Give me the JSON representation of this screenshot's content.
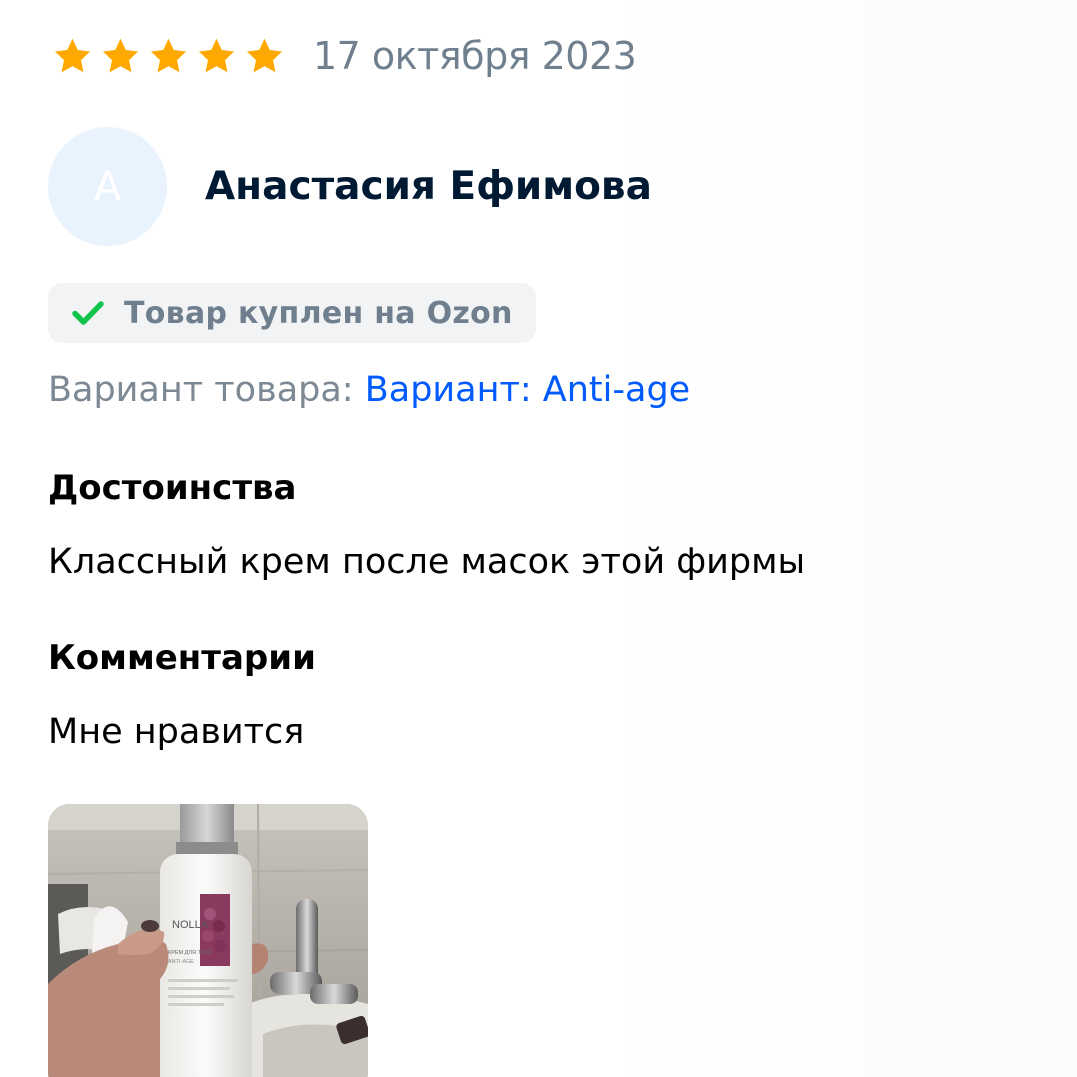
{
  "review": {
    "rating": 5,
    "rating_max": 5,
    "star_color": "#ffa800",
    "date": "17 октября 2023",
    "author": {
      "initial": "А",
      "name": "Анастасия Ефимова"
    },
    "badge": {
      "icon": "check-icon",
      "text": "Товар куплен на Ozon",
      "check_color": "#10c44c"
    },
    "variant": {
      "label": "Вариант товара: ",
      "value": "Вариант: Anti-age",
      "value_color": "#005bff"
    },
    "sections": [
      {
        "heading": "Достоинства",
        "text": "Классный крем после масок этой фирмы"
      },
      {
        "heading": "Комментарии",
        "text": "Мне нравится"
      }
    ],
    "photo": {
      "brand_text": "NOLLA",
      "product_text": "КРЕМ ДЛЯ ТЕЛА",
      "product_subtext": "ANTI-AGE"
    }
  }
}
